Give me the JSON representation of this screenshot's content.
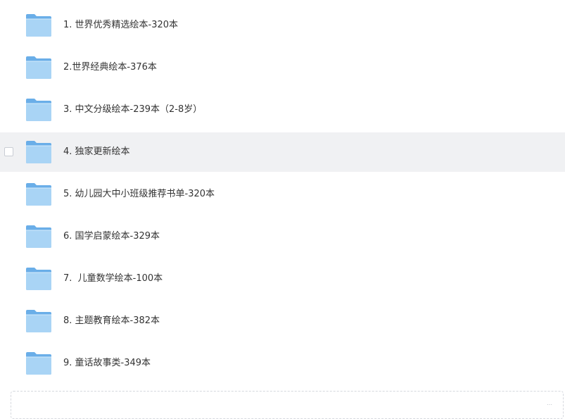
{
  "files": [
    {
      "name": "1. 世界优秀精选绘本-320本",
      "icon": "folder-icon",
      "hovered": false
    },
    {
      "name": "2.世界经典绘本-376本",
      "icon": "folder-icon",
      "hovered": false
    },
    {
      "name": "3. 中文分级绘本-239本（2-8岁）",
      "icon": "folder-icon",
      "hovered": false
    },
    {
      "name": "4. 独家更新绘本",
      "icon": "folder-icon",
      "hovered": true
    },
    {
      "name": "5. 幼儿园大中小班级推荐书单-320本",
      "icon": "folder-icon",
      "hovered": false
    },
    {
      "name": "6. 国学启蒙绘本-329本",
      "icon": "folder-icon",
      "hovered": false
    },
    {
      "name": "7.  儿童数学绘本-100本",
      "icon": "folder-icon",
      "hovered": false
    },
    {
      "name": "8. 主题教育绘本-382本",
      "icon": "folder-icon",
      "hovered": false
    },
    {
      "name": "9. 童话故事类-349本",
      "icon": "folder-icon",
      "hovered": false
    }
  ],
  "colors": {
    "folder_back": "#6aaee8",
    "folder_front": "#a9d4f5",
    "hover_background": "#f0f1f3",
    "text": "#333333"
  }
}
